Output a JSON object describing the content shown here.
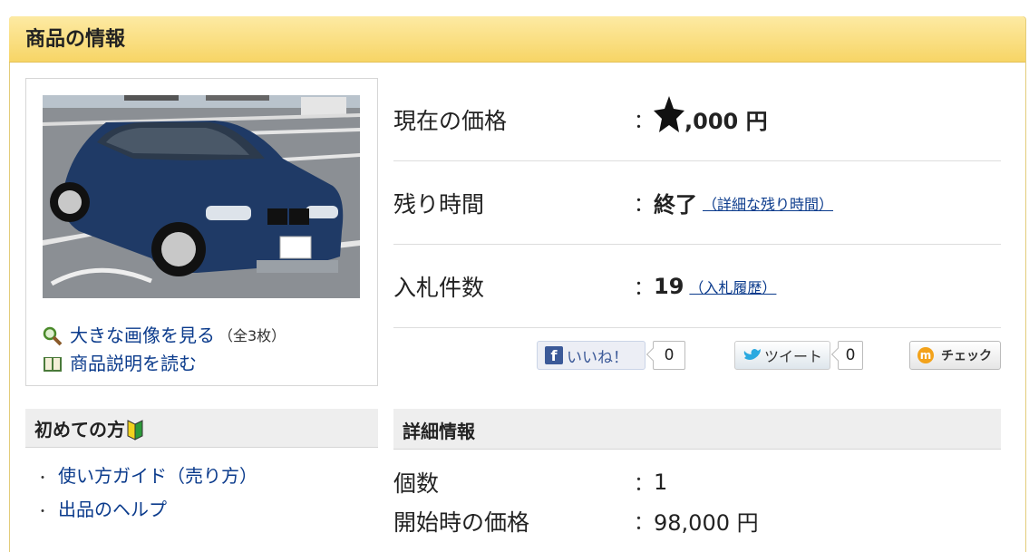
{
  "header": {
    "title": "商品の情報"
  },
  "photo_links": {
    "large_image": "大きな画像を見る",
    "large_image_count": "（全3枚）",
    "description": "商品説明を読む"
  },
  "info": {
    "price": {
      "label": "現在の価格",
      "colon": "：",
      "value": ",000 円"
    },
    "time": {
      "label": "残り時間",
      "colon": "：",
      "value": "終了",
      "link": "（詳細な残り時間）"
    },
    "bids": {
      "label": "入札件数",
      "colon": "：",
      "value": "19",
      "link": "（入札履歴）"
    }
  },
  "social": {
    "like_label": "いいね！",
    "like_count": "0",
    "tweet_label": "ツイート",
    "tweet_count": "0",
    "check_label": "チェック"
  },
  "beginner": {
    "title": "初めての方",
    "links": [
      "使い方ガイド（売り方）",
      "出品のヘルプ"
    ]
  },
  "detail": {
    "title": "詳細情報",
    "rows": [
      {
        "label": "個数",
        "colon": "：",
        "value": "1"
      },
      {
        "label": "開始時の価格",
        "colon": "：",
        "value": "98,000 円"
      }
    ]
  },
  "colors": {
    "header_bg": "#f7d566",
    "link": "#0b3b8c",
    "car_body": "#1f3a66"
  }
}
